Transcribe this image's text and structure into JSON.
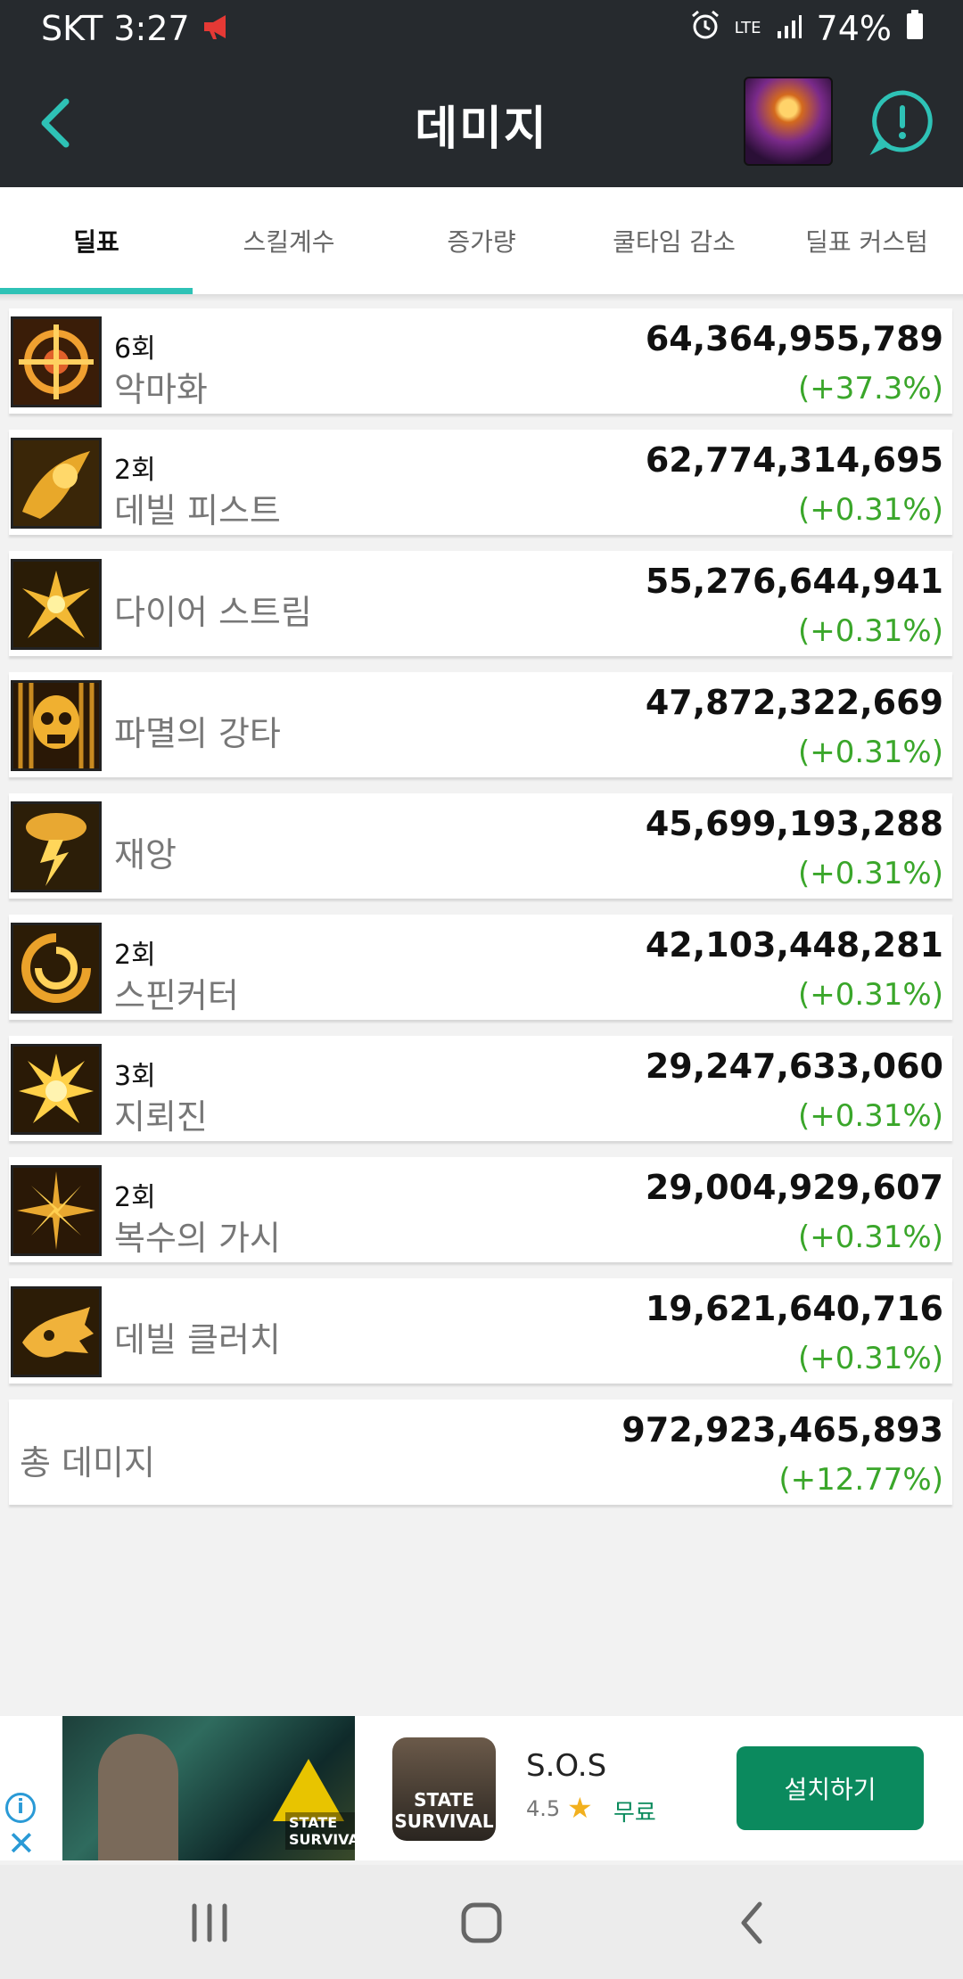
{
  "status_bar": {
    "carrier_time": "SKT 3:27",
    "signal_label": "LTE",
    "battery": "74%"
  },
  "app_bar": {
    "title": "데미지",
    "back_icon": "chevron-left-icon",
    "alert_icon": "alert-circle-icon",
    "accent_color": "#2ec2b6"
  },
  "tabs": [
    {
      "label": "딜표",
      "active": true
    },
    {
      "label": "스킬계수",
      "active": false
    },
    {
      "label": "증가량",
      "active": false
    },
    {
      "label": "쿨타임 감소",
      "active": false
    },
    {
      "label": "딜표 커스텀",
      "active": false
    }
  ],
  "skills": [
    {
      "count": "6회",
      "name": "악마화",
      "damage": "64,364,955,789",
      "change": "(+37.3%)",
      "icon": "crosshair-icon"
    },
    {
      "count": "2회",
      "name": "데빌 피스트",
      "damage": "62,774,314,695",
      "change": "(+0.31%)",
      "icon": "fist-icon"
    },
    {
      "count": "",
      "name": "다이어 스트림",
      "damage": "55,276,644,941",
      "change": "(+0.31%)",
      "icon": "burst-icon"
    },
    {
      "count": "",
      "name": "파멸의 강타",
      "damage": "47,872,322,669",
      "change": "(+0.31%)",
      "icon": "skull-icon"
    },
    {
      "count": "",
      "name": "재앙",
      "damage": "45,699,193,288",
      "change": "(+0.31%)",
      "icon": "storm-icon"
    },
    {
      "count": "2회",
      "name": "스핀커터",
      "damage": "42,103,448,281",
      "change": "(+0.31%)",
      "icon": "spin-icon"
    },
    {
      "count": "3회",
      "name": "지뢰진",
      "damage": "29,247,633,060",
      "change": "(+0.31%)",
      "icon": "explosion-icon"
    },
    {
      "count": "2회",
      "name": "복수의 가시",
      "damage": "29,004,929,607",
      "change": "(+0.31%)",
      "icon": "thorns-icon"
    },
    {
      "count": "",
      "name": "데빌 클러치",
      "damage": "19,621,640,716",
      "change": "(+0.31%)",
      "icon": "claw-icon"
    }
  ],
  "total": {
    "label": "총 데미지",
    "damage": "972,923,465,893",
    "change": "(+12.77%)"
  },
  "ad": {
    "app_name": "S.O.S",
    "rating": "4.5",
    "price": "무료",
    "install_label": "설치하기",
    "icon_text": "STATE SURVIVAL",
    "banner_text": "STATE SURVIVAL"
  },
  "colors": {
    "positive": "#3aa62a",
    "header_bg": "#262a2e",
    "install_bg": "#0b8a5e"
  }
}
